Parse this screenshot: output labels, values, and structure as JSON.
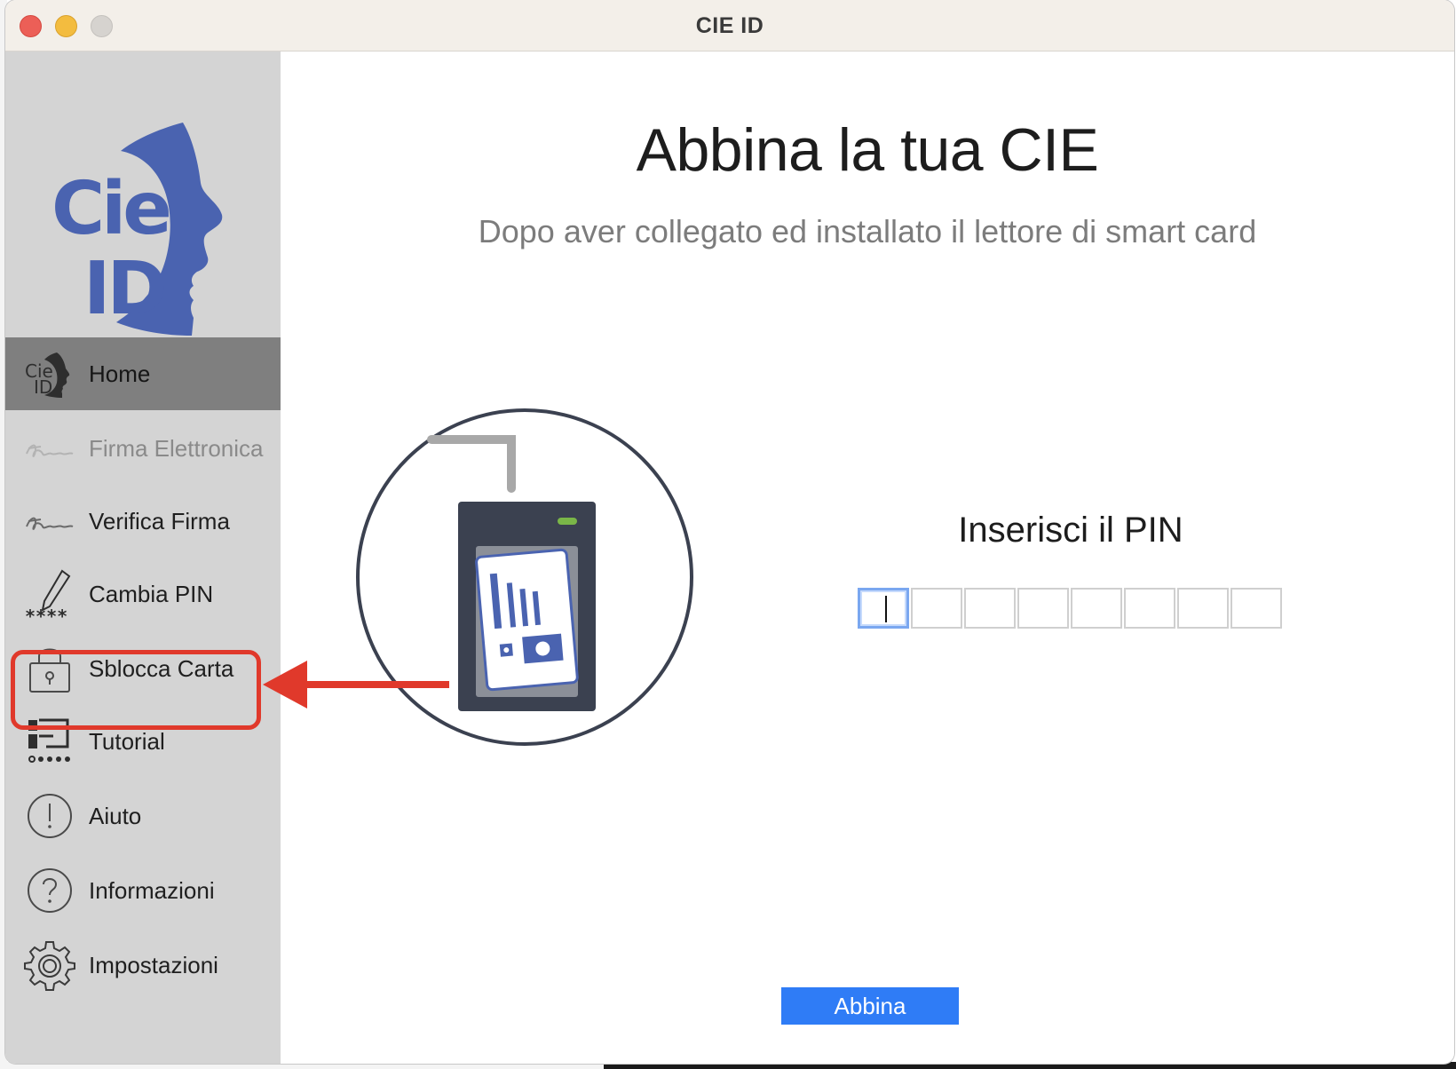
{
  "window": {
    "title": "CIE ID"
  },
  "sidebar": {
    "logo_text_line1": "Cie",
    "logo_text_line2": "ID",
    "items": [
      {
        "label": "Home",
        "icon": "cie-id-logo-icon",
        "active": true
      },
      {
        "label": "Firma Elettronica",
        "icon": "signature-icon",
        "disabled": true
      },
      {
        "label": "Verifica Firma",
        "icon": "signature-icon"
      },
      {
        "label": "Cambia PIN",
        "icon": "pencil-pin-icon"
      },
      {
        "label": "Sblocca Carta",
        "icon": "padlock-icon",
        "highlighted": true
      },
      {
        "label": "Tutorial",
        "icon": "presentation-icon"
      },
      {
        "label": "Aiuto",
        "icon": "exclamation-circle-icon"
      },
      {
        "label": "Informazioni",
        "icon": "question-circle-icon"
      },
      {
        "label": "Impostazioni",
        "icon": "gear-icon"
      }
    ]
  },
  "main": {
    "title": "Abbina la tua CIE",
    "subtitle": "Dopo aver collegato ed installato il lettore di smart card",
    "pin_label": "Inserisci il PIN",
    "pin_digits": 8,
    "pin_value": "",
    "submit_label": "Abbina"
  },
  "colors": {
    "brand_blue": "#4a63b0",
    "highlight_red": "#e0392b",
    "button_blue": "#2f7cf6",
    "sidebar_bg": "#d4d4d4",
    "sidebar_active": "#7f7f7f"
  }
}
